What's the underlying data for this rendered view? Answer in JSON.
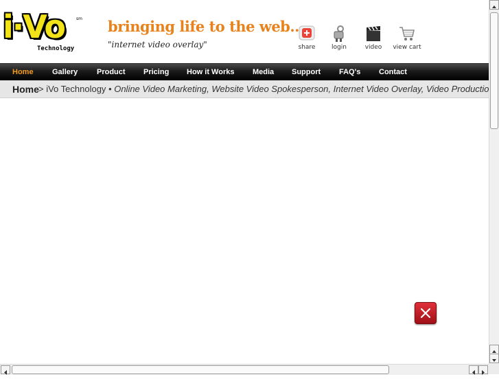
{
  "brand": {
    "logo_text": "i·Vo",
    "logo_mark": "sm",
    "logo_sub": "Technology"
  },
  "header": {
    "tagline": "bringing life to the web...",
    "subtag": "\"internet video overlay\"",
    "icons": [
      {
        "label": "share",
        "icon": "share-icon"
      },
      {
        "label": "login",
        "icon": "login-icon"
      },
      {
        "label": "video",
        "icon": "video-icon"
      },
      {
        "label": "view cart",
        "icon": "cart-icon"
      }
    ]
  },
  "nav": {
    "items": [
      {
        "label": "Home",
        "active": true
      },
      {
        "label": "Gallery"
      },
      {
        "label": "Product"
      },
      {
        "label": "Pricing"
      },
      {
        "label": "How it Works"
      },
      {
        "label": "Media"
      },
      {
        "label": "Support"
      },
      {
        "label": "FAQ's"
      },
      {
        "label": "Contact"
      }
    ]
  },
  "breadcrumb": {
    "home": "Home",
    "current": "> iVo Technology",
    "description": "• Online Video Marketing, Website Video Spokesperson, Internet Video Overlay, Video Production"
  },
  "overlay": {
    "close_icon": "close-icon",
    "close_color": "#cc2230"
  },
  "colors": {
    "accent": "#f29a1e",
    "tagline": "#e8821c",
    "logo": "#f2e318"
  }
}
